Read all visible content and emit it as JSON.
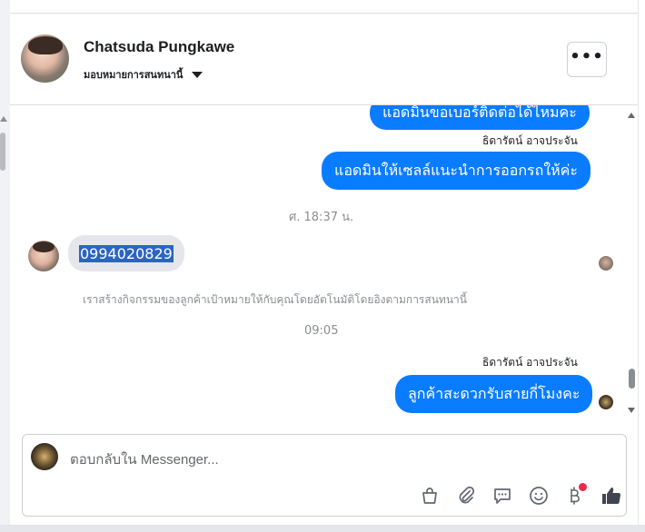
{
  "header": {
    "contact_name": "Chatsuda Pungkawe",
    "assign_label": "มอบหมายการสนทนานี้",
    "more_label": "•••"
  },
  "thread": {
    "messages_out_1": "แอดมินขอเบอร์ติดต่อได้ไหมคะ",
    "sender_1": "ธิดารัตน์ อาจประจัน",
    "messages_out_2": "แอดมินให้เซลล์แนะนำการออกรถให้ค่ะ",
    "timestamp_1": "ศ. 18:37 น.",
    "incoming_phone": "0994020829",
    "system_note": "เราสร้างกิจกรรมของลูกค้าเป้าหมายให้กับคุณโดยอัตโนมัติโดยอิงตามการสนทนานี้",
    "timestamp_2": "09:05",
    "sender_2": "ธิดารัตน์ อาจประจัน",
    "messages_out_3": "ลูกค้าสะดวกรับสายกี่โมงคะ"
  },
  "composer": {
    "placeholder": "ตอบกลับใน Messenger..."
  },
  "colors": {
    "outgoing_bubble": "#0a7cff",
    "incoming_bubble": "#e4e6eb",
    "selection": "#2b64c6",
    "notification_dot": "#f02849"
  },
  "icons": [
    "shopping-bag-icon",
    "paperclip-icon",
    "saved-reply-icon",
    "emoji-icon",
    "baht-payment-icon",
    "thumbs-up-icon"
  ]
}
